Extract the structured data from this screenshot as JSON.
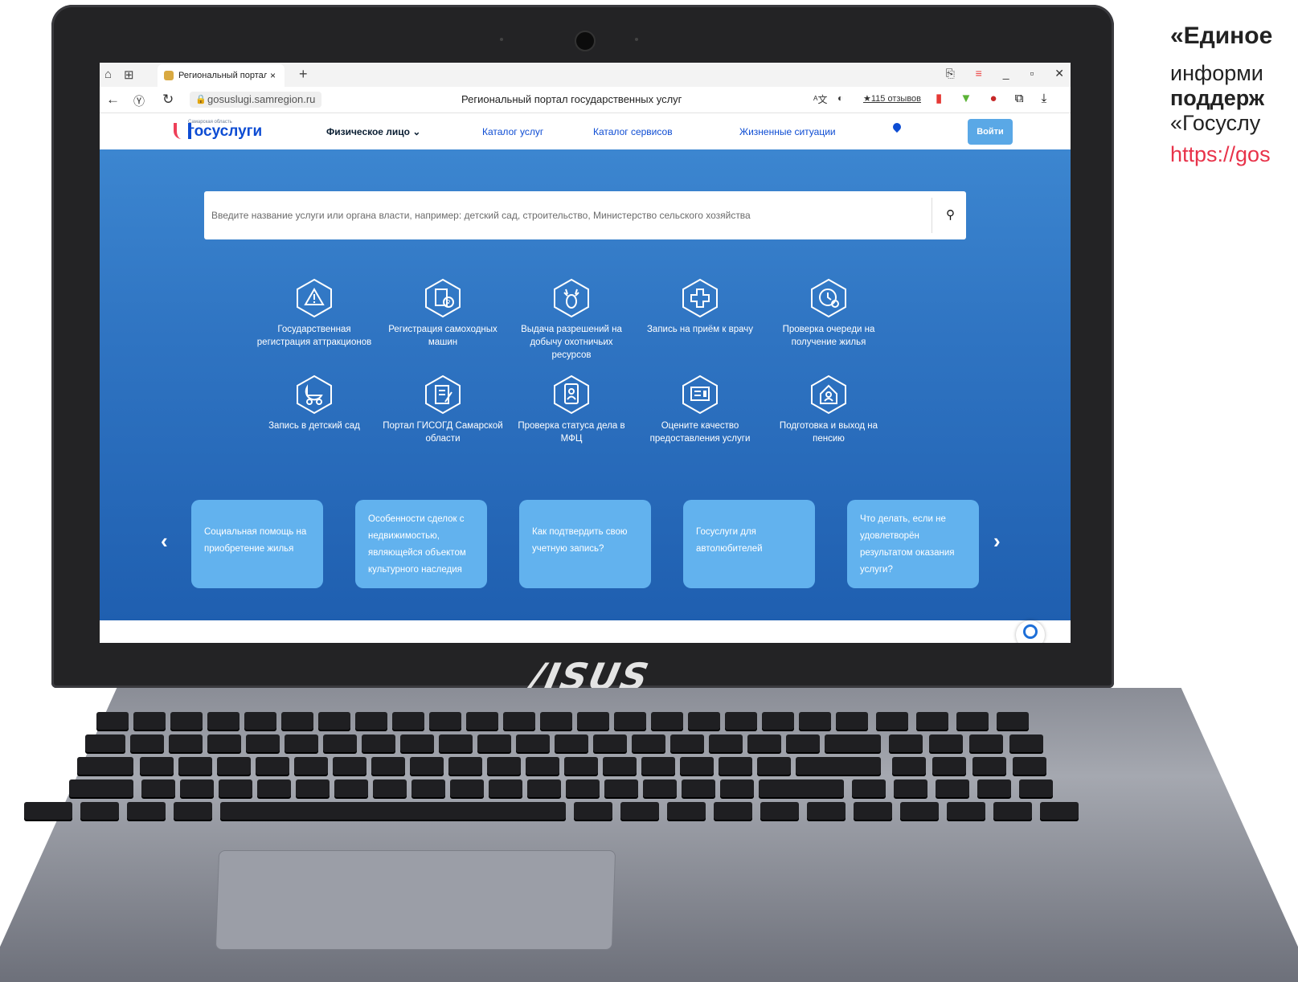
{
  "browser": {
    "tab_title": "Региональный портал г",
    "tab_close": "×",
    "new_tab": "+",
    "url": "gosuslugi.samregion.ru",
    "page_title": "Региональный портал государственных услуг",
    "reviews": "★115 отзывов",
    "window_controls": [
      "_",
      "▫",
      "✕"
    ]
  },
  "site": {
    "logo_subtitle": "Самарская область",
    "logo_title": "госуслуги",
    "nav": {
      "person_type": "Физическое лицо ⌄",
      "catalog_services": "Каталог услуг",
      "catalog_tools": "Каталог сервисов",
      "life_situations": "Жизненные ситуации",
      "login": "Войти"
    },
    "search": {
      "placeholder": "Введите название услуги или органа власти, например: детский сад, строительство, Министерство сельского хозяйства",
      "button_icon": "search-icon"
    },
    "services": [
      {
        "label": "Государственная регистрация аттракционов",
        "icon": "warning-icon"
      },
      {
        "label": "Регистрация самоходных машин",
        "icon": "document-ruble-icon"
      },
      {
        "label": "Выдача разрешений на добычу охотничьих ресурсов",
        "icon": "deer-icon"
      },
      {
        "label": "Запись на приём к врачу",
        "icon": "medical-cross-icon"
      },
      {
        "label": "Проверка очереди на получение жилья",
        "icon": "clock-icon"
      },
      {
        "label": "Запись в детский сад",
        "icon": "stroller-icon"
      },
      {
        "label": "Портал ГИСОГД Самарской области",
        "icon": "edit-document-icon"
      },
      {
        "label": "Проверка статуса дела в МФЦ",
        "icon": "id-card-icon"
      },
      {
        "label": "Оцените качество предоставления услуги",
        "icon": "rating-form-icon"
      },
      {
        "label": "Подготовка и выход на пенсию",
        "icon": "pension-house-icon"
      }
    ],
    "banners": [
      "Социальная помощь на приобретение жилья",
      "Особенности сделок с недвижимостью, являющейся объектом культурного наследия",
      "Как подтвердить свою учетную запись?",
      "Госуслуги для автолюбителей",
      "Что делать, если не удовлетворён результатом оказания услуги?"
    ],
    "prev_arrow": "‹",
    "next_arrow": "›"
  },
  "laptop": {
    "brand": "/ISUS"
  },
  "side_text": {
    "heading": "«Единое",
    "line1": "информи",
    "line2": "поддерж",
    "line3": "«Госуслу",
    "link": "https://gos"
  },
  "colors": {
    "hero_top": "#3c86d0",
    "hero_bottom": "#1f5fb0",
    "banner": "#62b2ee",
    "brand_blue": "#0d4cd3",
    "brand_red": "#ee3f58",
    "link_red": "#e8334a"
  }
}
